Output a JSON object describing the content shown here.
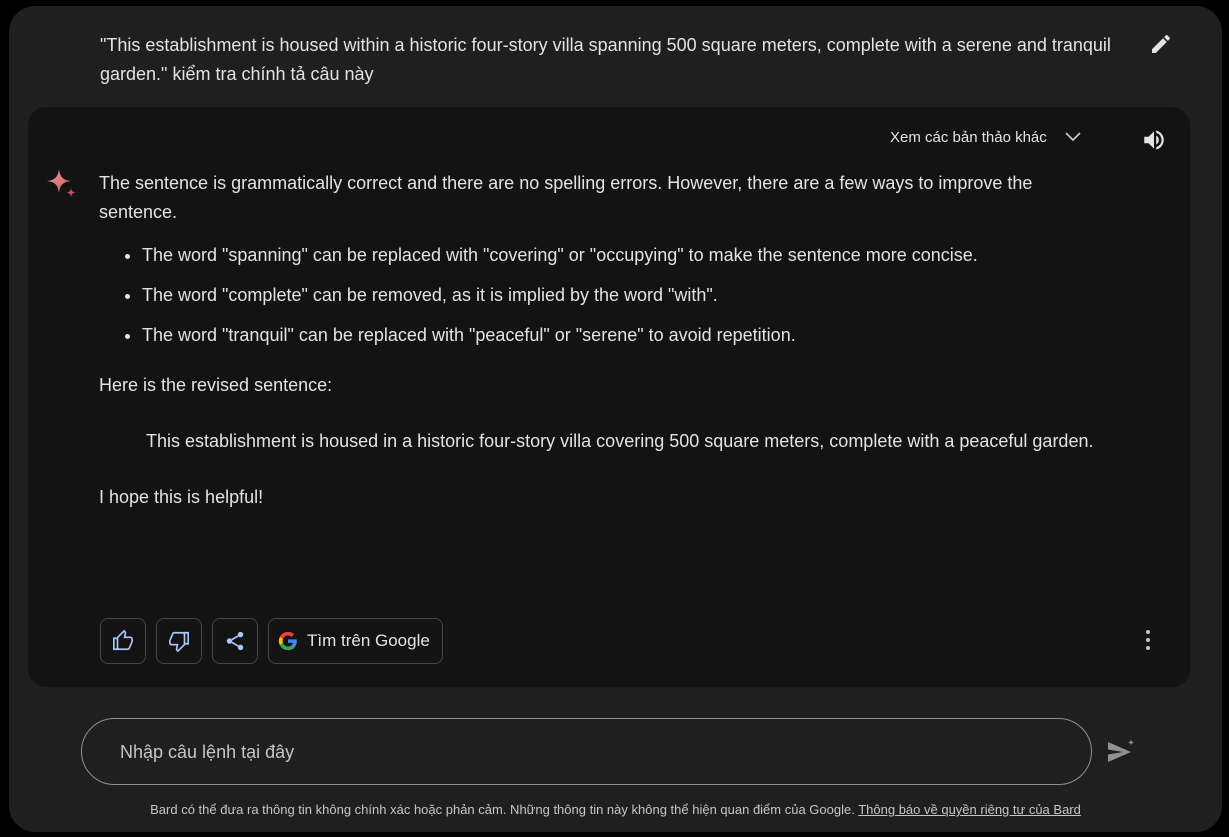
{
  "prompt": {
    "text": "\"This establishment is housed within a historic four-story villa spanning 500 square meters, complete with a serene and tranquil garden.\" kiểm tra chính tả câu này"
  },
  "response": {
    "drafts_label": "Xem các bản thảo khác",
    "intro": "The sentence is grammatically correct and there are no spelling errors. However, there are a few ways to improve the sentence.",
    "bullets": [
      "The word \"spanning\" can be replaced with \"covering\" or \"occupying\" to make the sentence more concise.",
      "The word \"complete\" can be removed, as it is implied by the word \"with\".",
      "The word \"tranquil\" can be replaced with \"peaceful\" or \"serene\" to avoid repetition."
    ],
    "revised_intro": "Here is the revised sentence:",
    "revised_sentence": "This establishment is housed in a historic four-story villa covering 500 square meters, complete with a peaceful garden.",
    "closing": "I hope this is helpful!",
    "google_button_label": "Tìm trên Google"
  },
  "icons": {
    "edit": "pencil-icon",
    "speaker": "speaker-icon",
    "sparkle": "bard-sparkle-icon",
    "thumbs_up": "thumbs-up-icon",
    "thumbs_down": "thumbs-down-icon",
    "share": "share-icon",
    "google": "google-g-icon",
    "more": "more-vert-icon",
    "send": "send-icon",
    "chevron": "chevron-down-icon"
  },
  "input": {
    "placeholder": "Nhập câu lệnh tại đây",
    "value": ""
  },
  "footer": {
    "disclaimer": "Bard có thể đưa ra thông tin không chính xác hoặc phản cảm. Những thông tin này không thể hiện quan điểm của Google.",
    "privacy_link": "Thông báo về quyền riêng tư của Bard"
  },
  "colors": {
    "page_bg": "#1f1f20",
    "card_bg": "#131314",
    "text": "#e3e3e3",
    "border": "#444746"
  }
}
